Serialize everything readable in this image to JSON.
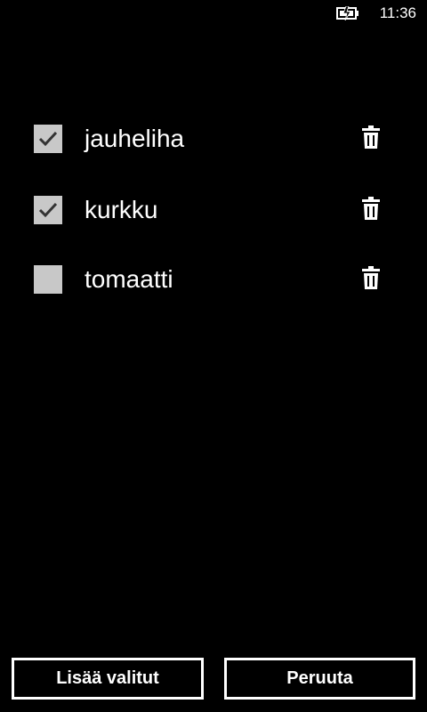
{
  "status_bar": {
    "time": "11:36",
    "battery_icon": "battery-charging-icon"
  },
  "items": [
    {
      "label": "jauheliha",
      "checked": true
    },
    {
      "label": "kurkku",
      "checked": true
    },
    {
      "label": "tomaatti",
      "checked": false
    }
  ],
  "icons": {
    "checkbox_checked": "checkmark-icon",
    "delete": "trash-icon"
  },
  "buttons": {
    "add_label": "Lisää valitut",
    "cancel_label": "Peruuta"
  },
  "colors": {
    "background": "#000000",
    "foreground": "#ffffff",
    "checkbox_fill": "#c8c8c8",
    "checkmark": "#333333"
  }
}
